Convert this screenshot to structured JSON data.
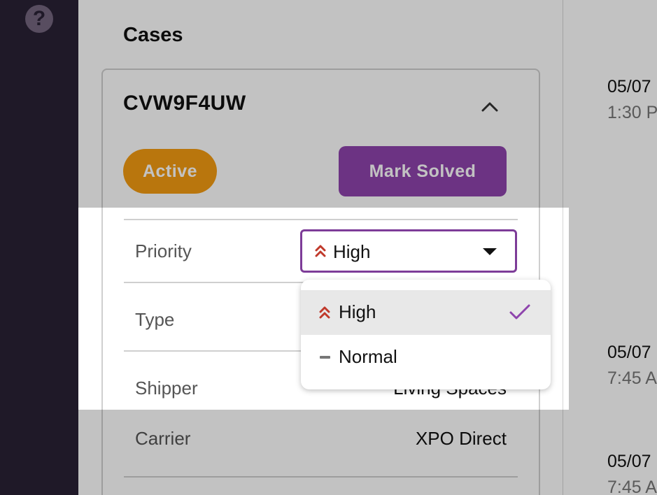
{
  "sidebar": {
    "help_icon": "question-mark-icon",
    "help_glyph": "?"
  },
  "cases": {
    "title": "Cases"
  },
  "case": {
    "id": "CVW9F4UW",
    "collapse_icon": "chevron-up-icon",
    "status_badge": "Active",
    "mark_solved_label": "Mark Solved",
    "fields": {
      "priority_label": "Priority",
      "type_label": "Type",
      "shipper_label": "Shipper",
      "shipper_value": "Living Spaces",
      "carrier_label": "Carrier",
      "carrier_value": "XPO Direct"
    }
  },
  "priority_select": {
    "selected": "High",
    "selected_icon": "double-chevron-up-icon",
    "caret_icon": "caret-down-icon",
    "options": [
      {
        "label": "High",
        "icon": "double-chevron-up-icon",
        "selected": true
      },
      {
        "label": "Normal",
        "icon": "dash-icon",
        "selected": false
      }
    ]
  },
  "timeline": [
    {
      "date": "05/07",
      "time": "1:30 P"
    },
    {
      "date": "05/07",
      "time": "7:45 A"
    },
    {
      "date": "05/07",
      "time": "7:45 A"
    }
  ],
  "colors": {
    "sidebar": "#3a2f4a",
    "accent_purple": "#8e44ad",
    "active_orange": "#f39c12",
    "priority_high_red": "#c0392b"
  }
}
